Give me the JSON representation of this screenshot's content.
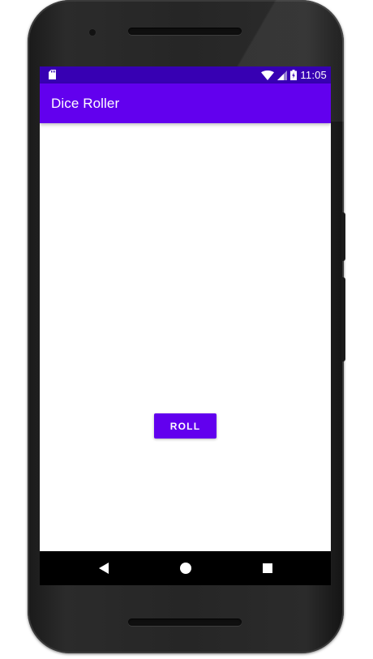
{
  "status_bar": {
    "time": "11:05",
    "icons": [
      "sd-card-icon",
      "wifi-icon",
      "cell-signal-icon",
      "battery-charging-icon"
    ],
    "background": "#3700b3"
  },
  "app_bar": {
    "title": "Dice Roller",
    "background": "#6200ee"
  },
  "main": {
    "roll_button_label": "ROLL",
    "accent": "#6200ee"
  },
  "nav_bar": {
    "buttons": [
      "back-icon",
      "home-icon",
      "recents-icon"
    ]
  }
}
